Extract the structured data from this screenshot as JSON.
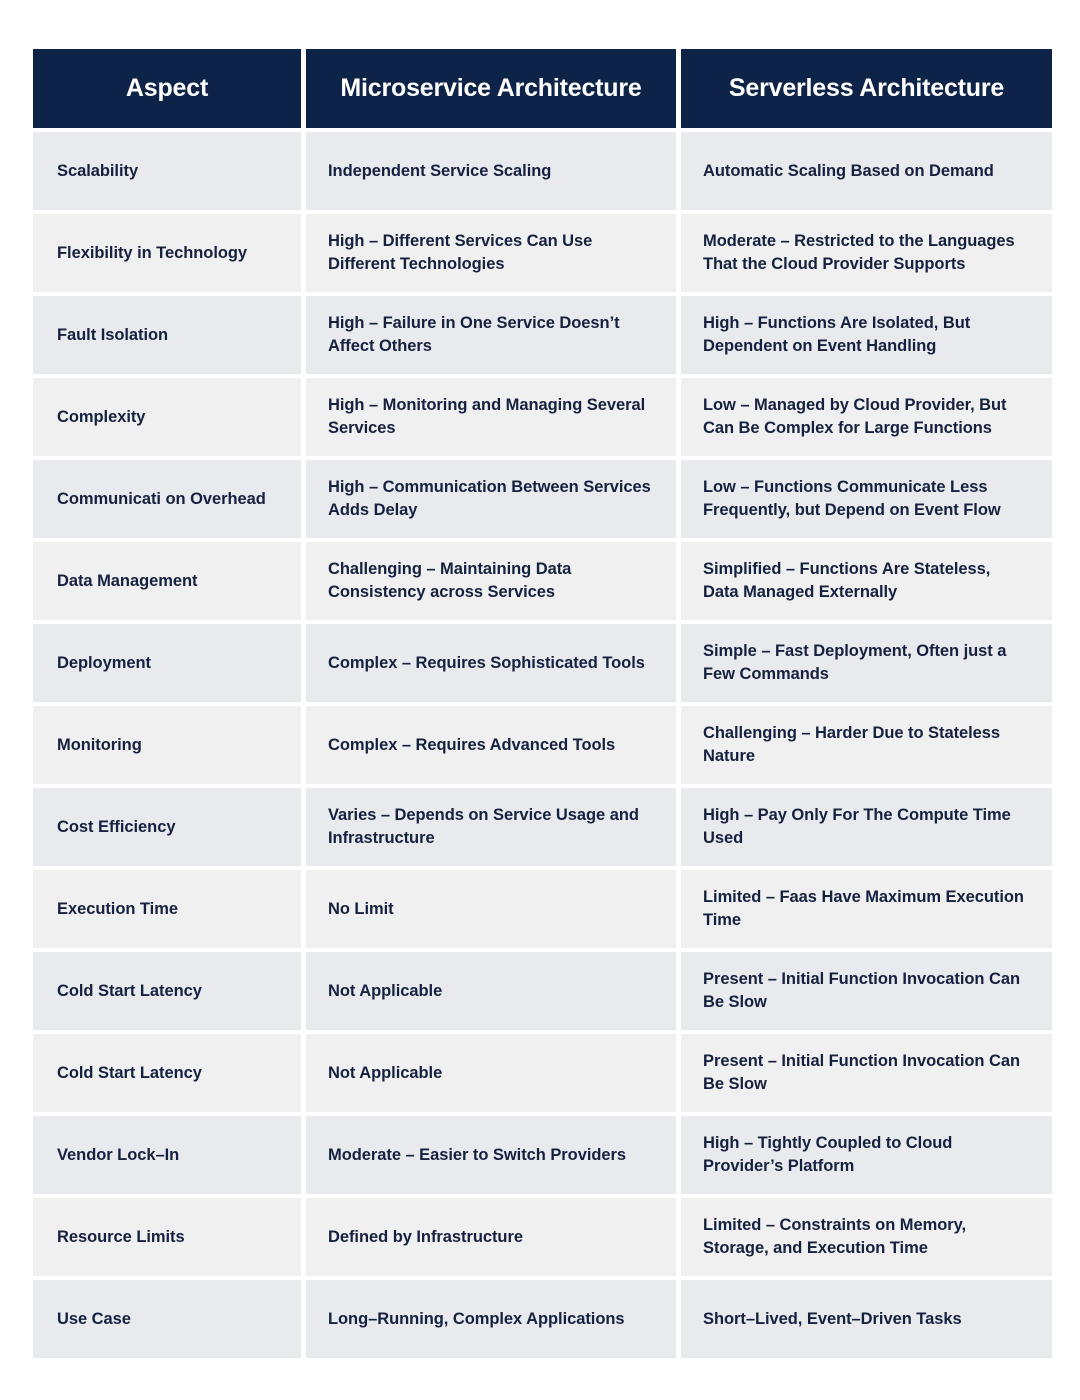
{
  "table": {
    "headers": [
      "Aspect",
      "Microservice Architecture",
      "Serverless Architecture"
    ],
    "colors": {
      "header_background": "#0d2348",
      "header_text": "#ffffff",
      "cell_text": "#16213f",
      "row_shade_a": "#e8eaee",
      "row_shade_b": "#f0f0f0",
      "page_background": "#ffffff"
    },
    "rows": [
      {
        "aspect": "Scalability",
        "microservice": "Independent Service Scaling",
        "serverless": "Automatic Scaling Based on Demand"
      },
      {
        "aspect": "Flexibility in Technology",
        "microservice": "High – Different Services Can Use Different Technologies",
        "serverless": "Moderate – Restricted to the Languages That the Cloud Provider Supports"
      },
      {
        "aspect": "Fault Isolation",
        "microservice": "High – Failure in One Service Doesn’t Affect Others",
        "serverless": "High – Functions Are Isolated, But Dependent on Event Handling"
      },
      {
        "aspect": "Complexity",
        "microservice": "High – Monitoring and Managing Several Services",
        "serverless": "Low – Managed by Cloud Provider, But Can Be Complex for Large Functions"
      },
      {
        "aspect": "Communicati on Overhead",
        "microservice": "High – Communication Between Services Adds Delay",
        "serverless": "Low – Functions Communicate Less Frequently, but Depend on Event Flow"
      },
      {
        "aspect": "Data Management",
        "microservice": "Challenging – Maintaining Data Consistency across Services",
        "serverless": "Simplified – Functions Are Stateless, Data Managed Externally"
      },
      {
        "aspect": "Deployment",
        "microservice": "Complex – Requires Sophisticated Tools",
        "serverless": "Simple – Fast Deployment, Often just a Few Commands"
      },
      {
        "aspect": "Monitoring",
        "microservice": "Complex – Requires Advanced Tools",
        "serverless": "Challenging – Harder Due to Stateless Nature"
      },
      {
        "aspect": "Cost Efficiency",
        "microservice": "Varies – Depends on Service Usage and Infrastructure",
        "serverless": "High – Pay Only For The Compute Time Used"
      },
      {
        "aspect": "Execution Time",
        "microservice": "No Limit",
        "serverless": "Limited – Faas Have Maximum Execution Time"
      },
      {
        "aspect": "Cold Start Latency",
        "microservice": "Not Applicable",
        "serverless": "Present – Initial Function Invocation Can Be Slow"
      },
      {
        "aspect": "Cold Start Latency",
        "microservice": "Not Applicable",
        "serverless": "Present – Initial Function Invocation Can Be Slow"
      },
      {
        "aspect": "Vendor Lock–In",
        "microservice": "Moderate – Easier to Switch Providers",
        "serverless": "High – Tightly Coupled to Cloud Provider’s Platform"
      },
      {
        "aspect": "Resource Limits",
        "microservice": "Defined by Infrastructure",
        "serverless": "Limited – Constraints on Memory, Storage, and Execution Time"
      },
      {
        "aspect": "Use Case",
        "microservice": "Long–Running, Complex Applications",
        "serverless": "Short–Lived, Event–Driven Tasks"
      }
    ]
  }
}
